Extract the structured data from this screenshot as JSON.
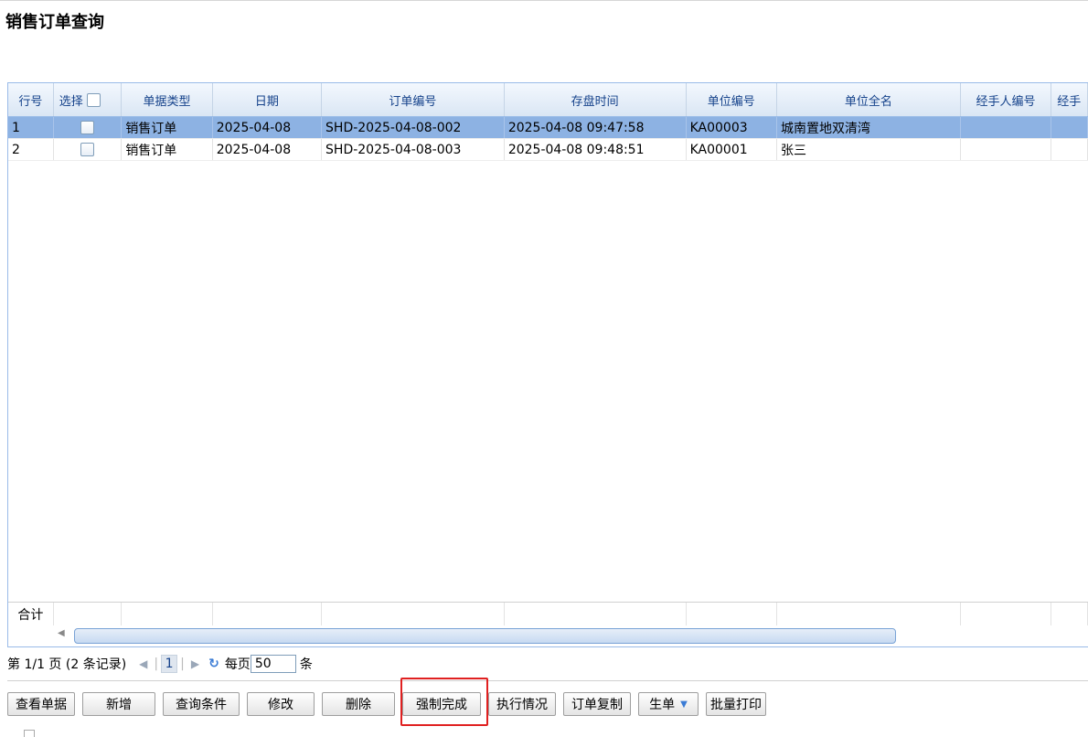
{
  "page": {
    "title": "销售订单查询"
  },
  "grid": {
    "select_label": "选择",
    "columns": [
      "行号",
      "选择",
      "单据类型",
      "日期",
      "订单编号",
      "存盘时间",
      "单位编号",
      "单位全名",
      "经手人编号",
      "经手"
    ],
    "rows": [
      {
        "num": "1",
        "type": "销售订单",
        "date": "2025-04-08",
        "order_no": "SHD-2025-04-08-002",
        "saved_at": "2025-04-08 09:47:58",
        "unit_no": "KA00003",
        "unit_name": "城南置地双清湾",
        "handler_no": "",
        "handler": ""
      },
      {
        "num": "2",
        "type": "销售订单",
        "date": "2025-04-08",
        "order_no": "SHD-2025-04-08-003",
        "saved_at": "2025-04-08 09:48:51",
        "unit_no": "KA00001",
        "unit_name": "张三",
        "handler_no": "",
        "handler": ""
      }
    ],
    "selected_row": 1,
    "summary_label": "合计"
  },
  "pager": {
    "summary": "第 1/1 页 (2 条记录)",
    "current_page": "1",
    "per_page_label": "每页",
    "page_size": "50",
    "unit": "条"
  },
  "toolbar": {
    "view": "查看单据",
    "add": "新增",
    "query": "查询条件",
    "edit": "修改",
    "delete": "删除",
    "force_complete": "强制完成",
    "exec_status": "执行情况",
    "copy_order": "订单复制",
    "generate": "生单",
    "batch_print": "批量打印"
  },
  "colors": {
    "header_text": "#15428b",
    "selected_row": "#8db2e3",
    "highlight_border": "#e02020"
  },
  "icons": {
    "prev": "triangle-left-icon",
    "next": "triangle-right-icon",
    "refresh": "refresh-icon",
    "dropdown": "chevron-down-icon"
  }
}
